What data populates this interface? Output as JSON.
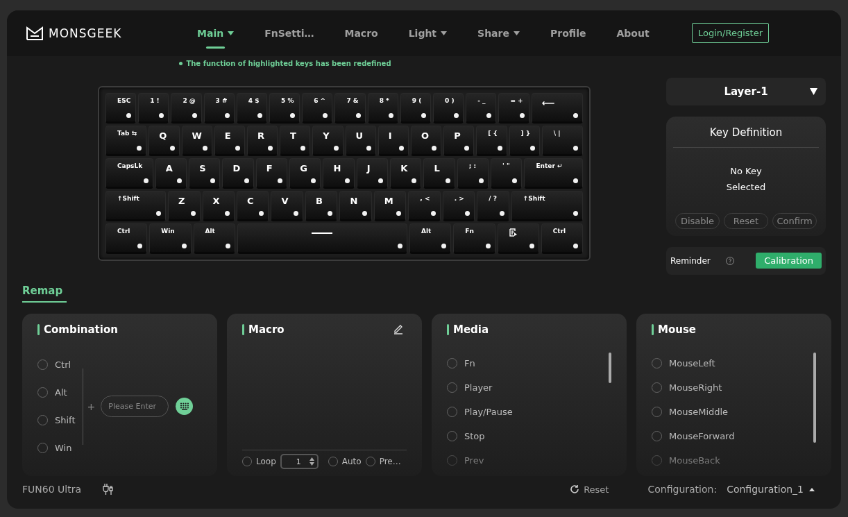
{
  "brand": "MONSGEEK",
  "nav": [
    {
      "label": "Main",
      "selected": true,
      "dropdown": true
    },
    {
      "label": "FnSetti…",
      "selected": false,
      "dropdown": false
    },
    {
      "label": "Macro",
      "selected": false,
      "dropdown": false
    },
    {
      "label": "Light",
      "selected": false,
      "dropdown": true
    },
    {
      "label": "Share",
      "selected": false,
      "dropdown": true
    },
    {
      "label": "Profile",
      "selected": false,
      "dropdown": false
    },
    {
      "label": "About",
      "selected": false,
      "dropdown": false
    }
  ],
  "login_button": "Login/Register",
  "notice": "The function of highlighted keys has been redefined",
  "keyboard": {
    "rows": [
      {
        "keys": [
          {
            "label": "ESC"
          },
          {
            "label": "1 !"
          },
          {
            "label": "2 @"
          },
          {
            "label": "3 #"
          },
          {
            "label": "4 $"
          },
          {
            "label": "5 %"
          },
          {
            "label": "6 ^"
          },
          {
            "label": "7 &"
          },
          {
            "label": "8 *"
          },
          {
            "label": "9 ("
          },
          {
            "label": "0 )"
          },
          {
            "label": "- _"
          },
          {
            "label": "= +"
          },
          {
            "label": "⟵"
          }
        ]
      },
      {
        "keys": [
          {
            "label": "Tab ⇆"
          },
          {
            "label": "Q"
          },
          {
            "label": "W"
          },
          {
            "label": "E"
          },
          {
            "label": "R"
          },
          {
            "label": "T"
          },
          {
            "label": "Y"
          },
          {
            "label": "U"
          },
          {
            "label": "I"
          },
          {
            "label": "O"
          },
          {
            "label": "P"
          },
          {
            "label": "[ {"
          },
          {
            "label": "] }"
          },
          {
            "label": "\\ |"
          }
        ]
      },
      {
        "keys": [
          {
            "label": "CapsLk"
          },
          {
            "label": "A"
          },
          {
            "label": "S"
          },
          {
            "label": "D"
          },
          {
            "label": "F"
          },
          {
            "label": "G"
          },
          {
            "label": "H"
          },
          {
            "label": "J"
          },
          {
            "label": "K"
          },
          {
            "label": "L"
          },
          {
            "label": "; :"
          },
          {
            "label": "' \""
          },
          {
            "label": "Enter ↵"
          }
        ]
      },
      {
        "keys": [
          {
            "label": "↑Shift"
          },
          {
            "label": "Z"
          },
          {
            "label": "X"
          },
          {
            "label": "C"
          },
          {
            "label": "V"
          },
          {
            "label": "B"
          },
          {
            "label": "N"
          },
          {
            "label": "M"
          },
          {
            "label": ", <"
          },
          {
            "label": ". >"
          },
          {
            "label": "/ ?"
          },
          {
            "label": "↑Shift"
          }
        ]
      },
      {
        "keys": [
          {
            "label": "Ctrl"
          },
          {
            "label": "Win"
          },
          {
            "label": "Alt"
          },
          {
            "kind": "space"
          },
          {
            "label": "Alt"
          },
          {
            "label": "Fn"
          },
          {
            "kind": "menu"
          },
          {
            "label": "Ctrl"
          }
        ]
      }
    ]
  },
  "layer_select": "Layer-1",
  "key_definition": {
    "title": "Key Definition",
    "message": "No Key Selected",
    "buttons": [
      "Disable",
      "Reset",
      "Confirm"
    ]
  },
  "reminder": {
    "label": "Reminder",
    "button": "Calibration"
  },
  "tabs": [
    {
      "label": "Remap",
      "selected": true
    }
  ],
  "combination": {
    "title": "Combination",
    "modifiers": [
      {
        "label": "Ctrl",
        "checked": false
      },
      {
        "label": "Alt",
        "checked": false
      },
      {
        "label": "Shift",
        "checked": false
      },
      {
        "label": "Win",
        "checked": false
      }
    ],
    "plus": "+",
    "input": {
      "placeholder": "Please Enter"
    }
  },
  "macro": {
    "title": "Macro",
    "options": [
      {
        "kind": "radio",
        "label": "Loop",
        "selected": false
      },
      {
        "kind": "stepper",
        "value": "1"
      },
      {
        "kind": "radio",
        "label": "Auto",
        "selected": false
      },
      {
        "kind": "radio",
        "label": "Pre…",
        "selected": false
      }
    ]
  },
  "media": {
    "title": "Media",
    "items": [
      {
        "label": "Fn",
        "selected": false
      },
      {
        "label": "Player",
        "selected": false
      },
      {
        "label": "Play/Pause",
        "selected": false
      },
      {
        "label": "Stop",
        "selected": false
      },
      {
        "label": "Prev",
        "selected": false
      }
    ]
  },
  "mouse": {
    "title": "Mouse",
    "items": [
      {
        "label": "MouseLeft",
        "selected": false
      },
      {
        "label": "MouseRight",
        "selected": false
      },
      {
        "label": "MouseMiddle",
        "selected": false
      },
      {
        "label": "MouseForward",
        "selected": false
      },
      {
        "label": "MouseBack",
        "selected": false
      }
    ]
  },
  "footer": {
    "device": "FUN60 Ultra",
    "reset": "Reset",
    "config_label": "Configuration:",
    "config_value": "Configuration_1"
  }
}
